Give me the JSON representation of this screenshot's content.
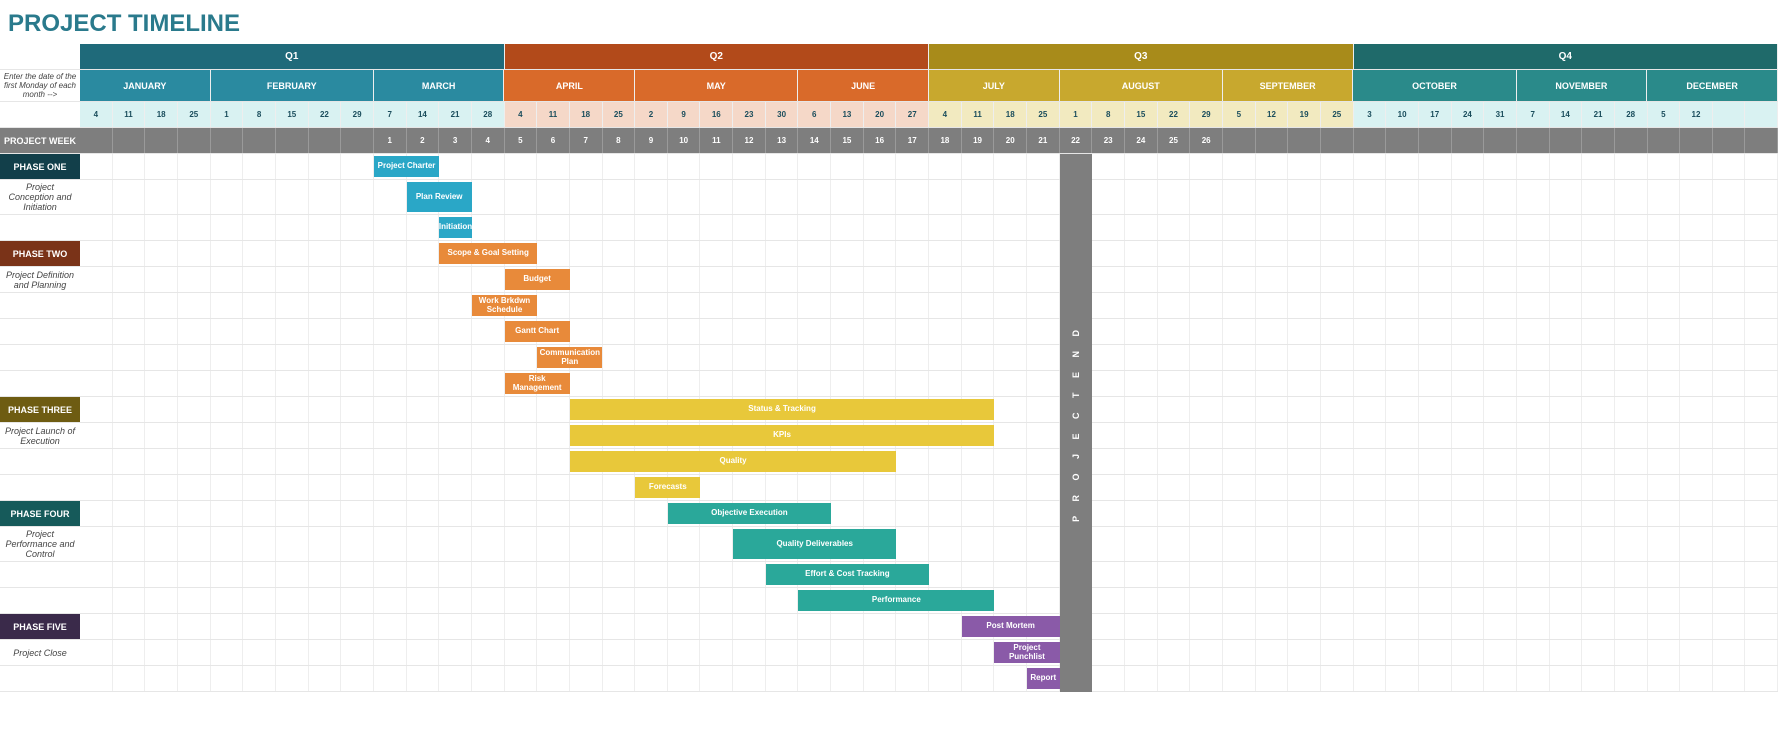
{
  "title": "PROJECT TIMELINE",
  "lab": {
    "note": "Enter the date of the first Monday of each month -->",
    "projectWeek": "PROJECT WEEK",
    "projectEnd": "PROJECT END"
  },
  "quarters": [
    {
      "name": "Q1",
      "span": 13,
      "class": "q1",
      "mclass": "m-q1",
      "dclass": "",
      "months": [
        {
          "name": "JANUARY",
          "days": [
            4,
            11,
            18,
            25
          ]
        },
        {
          "name": "FEBRUARY",
          "days": [
            1,
            8,
            15,
            22,
            29
          ]
        },
        {
          "name": "MARCH",
          "days": [
            7,
            14,
            21,
            28
          ]
        }
      ]
    },
    {
      "name": "Q2",
      "span": 13,
      "class": "q2",
      "mclass": "m-q2",
      "dclass": "day-q2",
      "months": [
        {
          "name": "APRIL",
          "days": [
            4,
            11,
            18,
            25
          ]
        },
        {
          "name": "MAY",
          "days": [
            2,
            9,
            16,
            23,
            30
          ]
        },
        {
          "name": "JUNE",
          "days": [
            6,
            13,
            20,
            27
          ]
        }
      ]
    },
    {
      "name": "Q3",
      "span": 13,
      "class": "q3",
      "mclass": "m-q3",
      "dclass": "day-q3",
      "months": [
        {
          "name": "JULY",
          "days": [
            4,
            11,
            18,
            25
          ]
        },
        {
          "name": "AUGUST",
          "days": [
            1,
            8,
            15,
            22,
            29
          ]
        },
        {
          "name": "SEPTEMBER",
          "days": [
            5,
            12,
            19,
            25
          ]
        }
      ]
    },
    {
      "name": "Q4",
      "span": 13,
      "class": "q4",
      "mclass": "m-q4",
      "dclass": "",
      "months": [
        {
          "name": "OCTOBER",
          "days": [
            3,
            10,
            17,
            24,
            31
          ]
        },
        {
          "name": "NOVEMBER",
          "days": [
            7,
            14,
            21,
            28
          ]
        },
        {
          "name": "DECEMBER",
          "days": [
            5,
            12,
            "",
            ""
          ]
        }
      ]
    }
  ],
  "projectWeeks": [
    null,
    null,
    null,
    null,
    null,
    null,
    null,
    null,
    null,
    1,
    2,
    3,
    4,
    5,
    6,
    7,
    8,
    9,
    10,
    11,
    12,
    13,
    14,
    15,
    16,
    17,
    18,
    19,
    20,
    21,
    22,
    23,
    24,
    25,
    26,
    null,
    null,
    null,
    null,
    null,
    null,
    null,
    null,
    null,
    null,
    null,
    null,
    null,
    null,
    null,
    null,
    null
  ],
  "projectEndCol": 30,
  "phases": [
    {
      "key": "p1",
      "label": "PHASE ONE",
      "sub": "Project Conception and Initiation",
      "bg": "p1",
      "tasks": [
        {
          "name": "Project Charter",
          "start": 9,
          "len": 2,
          "color": "#2aa7c7"
        },
        {
          "name": "Plan Review",
          "start": 10,
          "len": 2,
          "color": "#2aa7c7"
        },
        {
          "name": "Initiation",
          "start": 11,
          "len": 1,
          "color": "#2aa7c7"
        }
      ]
    },
    {
      "key": "p2",
      "label": "PHASE TWO",
      "sub": "Project Definition and Planning",
      "bg": "p2",
      "tasks": [
        {
          "name": "Scope & Goal Setting",
          "start": 11,
          "len": 3,
          "color": "#e88a3a"
        },
        {
          "name": "Budget",
          "start": 13,
          "len": 2,
          "color": "#e88a3a"
        },
        {
          "name": "Work Brkdwn Schedule",
          "start": 12,
          "len": 2,
          "color": "#e88a3a"
        },
        {
          "name": "Gantt Chart",
          "start": 13,
          "len": 2,
          "color": "#e88a3a"
        },
        {
          "name": "Communication Plan",
          "start": 14,
          "len": 2,
          "color": "#e88a3a"
        },
        {
          "name": "Risk Management",
          "start": 13,
          "len": 2,
          "color": "#e88a3a"
        }
      ]
    },
    {
      "key": "p3",
      "label": "PHASE THREE",
      "sub": "Project Launch of Execution",
      "bg": "p3",
      "tasks": [
        {
          "name": "Status & Tracking",
          "start": 15,
          "len": 13,
          "color": "#e8c83a"
        },
        {
          "name": "KPIs",
          "start": 15,
          "len": 13,
          "color": "#e8c83a"
        },
        {
          "name": "Quality",
          "start": 15,
          "len": 10,
          "color": "#e8c83a"
        },
        {
          "name": "Forecasts",
          "start": 17,
          "len": 2,
          "color": "#e8c83a"
        }
      ]
    },
    {
      "key": "p4",
      "label": "PHASE FOUR",
      "sub": "Project Performance and Control",
      "bg": "p4",
      "tasks": [
        {
          "name": "Objective Execution",
          "start": 18,
          "len": 5,
          "color": "#2aa89a"
        },
        {
          "name": "Quality Deliverables",
          "start": 20,
          "len": 5,
          "color": "#2aa89a"
        },
        {
          "name": "Effort & Cost Tracking",
          "start": 21,
          "len": 5,
          "color": "#2aa89a"
        },
        {
          "name": "Performance",
          "start": 22,
          "len": 6,
          "color": "#2aa89a"
        }
      ]
    },
    {
      "key": "p5",
      "label": "PHASE FIVE",
      "sub": "Project Close",
      "bg": "p5",
      "tasks": [
        {
          "name": "Post Mortem",
          "start": 27,
          "len": 3,
          "color": "#8a5aa8"
        },
        {
          "name": "Project Punchlist",
          "start": 28,
          "len": 2,
          "color": "#8a5aa8"
        },
        {
          "name": "Report",
          "start": 29,
          "len": 1,
          "color": "#8a5aa8"
        }
      ]
    }
  ],
  "chart_data": {
    "type": "gantt",
    "title": "PROJECT TIMELINE",
    "x_unit": "project_week",
    "x_range": [
      1,
      26
    ],
    "calendar": {
      "Q1": {
        "JANUARY": [
          4,
          11,
          18,
          25
        ],
        "FEBRUARY": [
          1,
          8,
          15,
          22,
          29
        ],
        "MARCH": [
          7,
          14,
          21,
          28
        ]
      },
      "Q2": {
        "APRIL": [
          4,
          11,
          18,
          25
        ],
        "MAY": [
          2,
          9,
          16,
          23,
          30
        ],
        "JUNE": [
          6,
          13,
          20,
          27
        ]
      },
      "Q3": {
        "JULY": [
          4,
          11,
          18,
          25
        ],
        "AUGUST": [
          1,
          8,
          15,
          22,
          29
        ],
        "SEPTEMBER": [
          5,
          12,
          19,
          25
        ]
      },
      "Q4": {
        "OCTOBER": [
          3,
          10,
          17,
          24,
          31
        ],
        "NOVEMBER": [
          7,
          14,
          21,
          28
        ],
        "DECEMBER": [
          5,
          12
        ]
      }
    },
    "phases": [
      {
        "phase": "PHASE ONE",
        "group": "Project Conception and Initiation",
        "color": "#2aa7c7",
        "tasks": [
          {
            "name": "Project Charter",
            "start_week": 1,
            "duration_weeks": 2
          },
          {
            "name": "Plan Review",
            "start_week": 2,
            "duration_weeks": 2
          },
          {
            "name": "Initiation",
            "start_week": 3,
            "duration_weeks": 1
          }
        ]
      },
      {
        "phase": "PHASE TWO",
        "group": "Project Definition and Planning",
        "color": "#e88a3a",
        "tasks": [
          {
            "name": "Scope & Goal Setting",
            "start_week": 3,
            "duration_weeks": 3
          },
          {
            "name": "Budget",
            "start_week": 5,
            "duration_weeks": 2
          },
          {
            "name": "Work Brkdwn Schedule",
            "start_week": 4,
            "duration_weeks": 2
          },
          {
            "name": "Gantt Chart",
            "start_week": 5,
            "duration_weeks": 2
          },
          {
            "name": "Communication Plan",
            "start_week": 6,
            "duration_weeks": 2
          },
          {
            "name": "Risk Management",
            "start_week": 5,
            "duration_weeks": 2
          }
        ]
      },
      {
        "phase": "PHASE THREE",
        "group": "Project Launch of Execution",
        "color": "#e8c83a",
        "tasks": [
          {
            "name": "Status & Tracking",
            "start_week": 7,
            "duration_weeks": 13
          },
          {
            "name": "KPIs",
            "start_week": 7,
            "duration_weeks": 13
          },
          {
            "name": "Quality",
            "start_week": 7,
            "duration_weeks": 10
          },
          {
            "name": "Forecasts",
            "start_week": 9,
            "duration_weeks": 2
          }
        ]
      },
      {
        "phase": "PHASE FOUR",
        "group": "Project Performance and Control",
        "color": "#2aa89a",
        "tasks": [
          {
            "name": "Objective Execution",
            "start_week": 10,
            "duration_weeks": 5
          },
          {
            "name": "Quality Deliverables",
            "start_week": 12,
            "duration_weeks": 5
          },
          {
            "name": "Effort & Cost Tracking",
            "start_week": 13,
            "duration_weeks": 5
          },
          {
            "name": "Performance",
            "start_week": 14,
            "duration_weeks": 6
          }
        ]
      },
      {
        "phase": "PHASE FIVE",
        "group": "Project Close",
        "color": "#8a5aa8",
        "tasks": [
          {
            "name": "Post Mortem",
            "start_week": 19,
            "duration_weeks": 3
          },
          {
            "name": "Project Punchlist",
            "start_week": 20,
            "duration_weeks": 2
          },
          {
            "name": "Report",
            "start_week": 21,
            "duration_weeks": 1
          }
        ]
      }
    ],
    "milestone": {
      "name": "PROJECT END",
      "week": 22
    }
  }
}
